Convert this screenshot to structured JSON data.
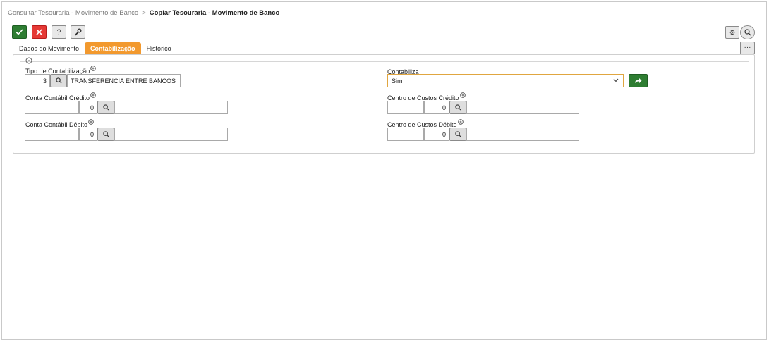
{
  "breadcrumb": {
    "parent": "Consultar Tesouraria - Movimento de Banco",
    "separator": ">",
    "current": "Copiar Tesouraria - Movimento de Banco"
  },
  "toolbar": {
    "help_label": "?"
  },
  "more_label": "···",
  "tabs": [
    {
      "label": "Dados do Movimento",
      "active": false
    },
    {
      "label": "Contabilização",
      "active": true
    },
    {
      "label": "Histórico",
      "active": false
    }
  ],
  "colors": {
    "accent_orange": "#f2992e",
    "confirm_green": "#2e7d32",
    "cancel_red": "#e53935"
  },
  "form": {
    "tipo_contabilizacao": {
      "label": "Tipo de Contabilização",
      "code": "3",
      "description": "TRANSFERENCIA ENTRE BANCOS"
    },
    "contabiliza": {
      "label": "Contabiliza",
      "value": "Sim"
    },
    "conta_credito": {
      "label": "Conta Contábil Crédito",
      "code": "",
      "number": "0",
      "description": ""
    },
    "centro_credito": {
      "label": "Centro de Custos Crédito",
      "code": "",
      "number": "0",
      "description": ""
    },
    "conta_debito": {
      "label": "Conta Contábil Débito",
      "code": "",
      "number": "0",
      "description": ""
    },
    "centro_debito": {
      "label": "Centro de Custos Débito",
      "code": "",
      "number": "0",
      "description": ""
    }
  }
}
